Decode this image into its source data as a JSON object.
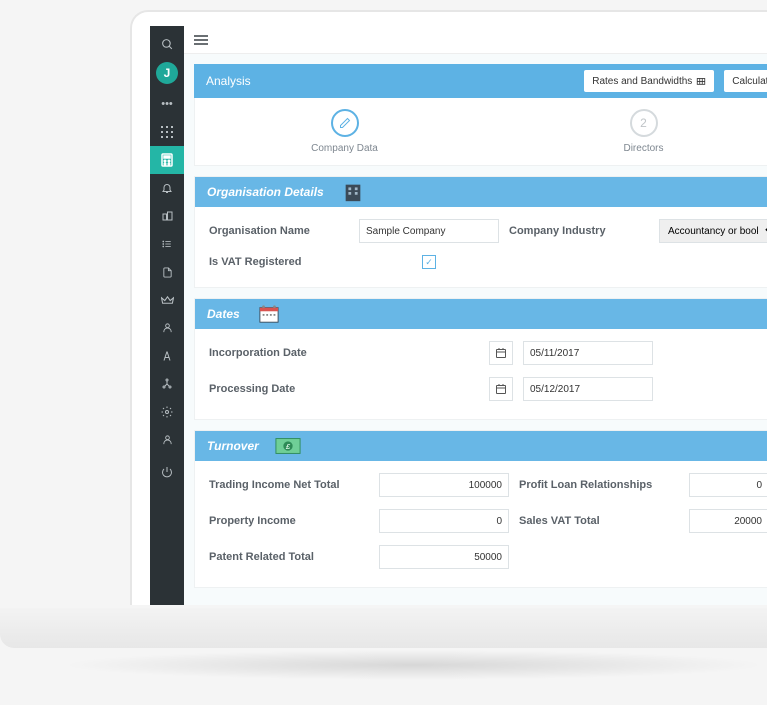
{
  "header": {
    "title": "Analysis",
    "rates_btn": "Rates and Bandwidths",
    "calc_btn": "Calculate"
  },
  "steps": {
    "one_label": "Company Data",
    "two_num": "2",
    "two_label": "Directors"
  },
  "org": {
    "panel_title": "Organisation Details",
    "name_label": "Organisation Name",
    "name_value": "Sample Company",
    "industry_label": "Company Industry",
    "industry_value": "Accountancy or book",
    "vat_label": "Is VAT Registered",
    "vat_checked": "✓"
  },
  "dates": {
    "panel_title": "Dates",
    "inc_label": "Incorporation Date",
    "inc_value": "05/11/2017",
    "proc_label": "Processing Date",
    "proc_value": "05/12/2017"
  },
  "turnover": {
    "panel_title": "Turnover",
    "trading_label": "Trading Income Net Total",
    "trading_value": "100000",
    "profit_label": "Profit Loan Relationships",
    "profit_value": "0",
    "property_label": "Property Income",
    "property_value": "0",
    "salesvat_label": "Sales VAT Total",
    "salesvat_value": "20000",
    "patent_label": "Patent Related Total",
    "patent_value": "50000"
  },
  "sidebar": {
    "logo": "J"
  }
}
